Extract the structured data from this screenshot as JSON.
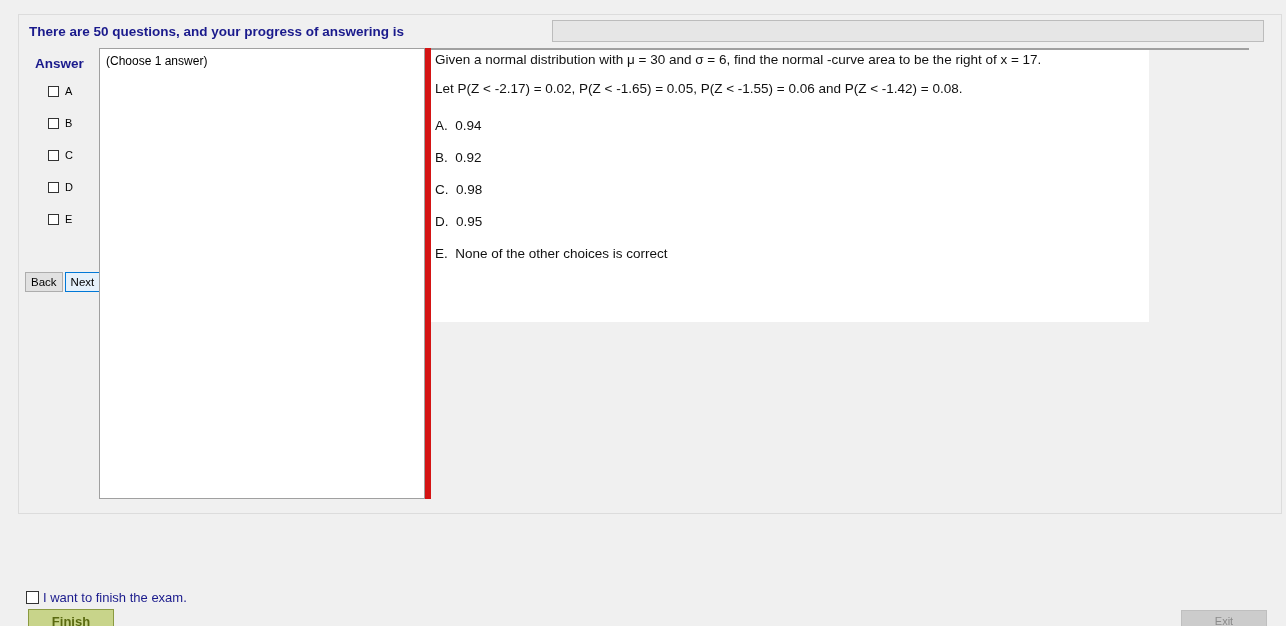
{
  "header": {
    "text": "There are 50 questions, and your progress of answering is",
    "progress": {
      "level": 0
    }
  },
  "answer_panel": {
    "title": "Answer",
    "options": [
      {
        "label": "A",
        "checked": false
      },
      {
        "label": "B",
        "checked": false
      },
      {
        "label": "C",
        "checked": false
      },
      {
        "label": "D",
        "checked": false
      },
      {
        "label": "E",
        "checked": false
      }
    ],
    "buttons": [
      {
        "label": "Back",
        "selected": false
      },
      {
        "label": "Next",
        "selected": true
      }
    ]
  },
  "instruction": "(Choose 1 answer)",
  "question": {
    "lines": [
      "Given a normal distribution with μ = 30 and σ = 6, find the normal -curve area to be the right of x = 17.",
      "Let P(Z < -2.17) = 0.02, P(Z < -1.65) = 0.05, P(Z < -1.55) = 0.06 and P(Z < -1.42) = 0.08."
    ],
    "choices": [
      "A.  0.94",
      "B.  0.92",
      "C.  0.98",
      "D.  0.95",
      "E.  None of the other choices is correct"
    ]
  },
  "finish": {
    "checkbox_label": "I want to finish the exam.",
    "checked": false,
    "button": "Finish"
  },
  "exit_button": {
    "label": "Exit",
    "disabled": true
  }
}
